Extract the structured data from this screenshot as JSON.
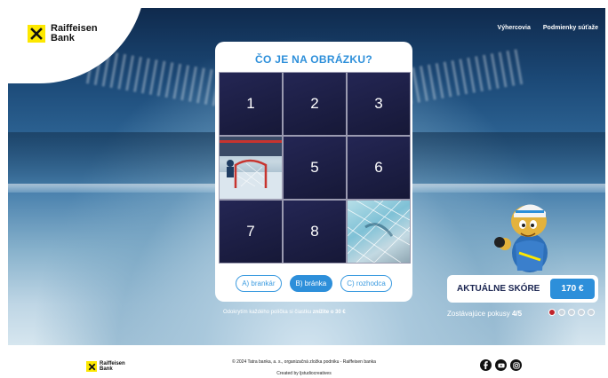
{
  "brand": {
    "line1": "Raiffeisen",
    "line2": "Bank"
  },
  "nav": {
    "winners": "Výhercovia",
    "terms": "Podmienky súťaže"
  },
  "quiz": {
    "title": "ČO JE NA OBRÁZKU?",
    "tiles": [
      {
        "label": "1",
        "revealed": false
      },
      {
        "label": "2",
        "revealed": false
      },
      {
        "label": "3",
        "revealed": false
      },
      {
        "label": "",
        "revealed": true
      },
      {
        "label": "5",
        "revealed": false
      },
      {
        "label": "6",
        "revealed": false
      },
      {
        "label": "7",
        "revealed": false
      },
      {
        "label": "8",
        "revealed": false
      },
      {
        "label": "",
        "revealed": true
      }
    ],
    "answers": [
      {
        "label": "A) brankár",
        "selected": false
      },
      {
        "label": "B) bránka",
        "selected": true
      },
      {
        "label": "C) rozhodca",
        "selected": false
      }
    ]
  },
  "hint": {
    "prefix": "Odokrytím každého políčka si čiastku ",
    "bold": "znížite o 30 €"
  },
  "score": {
    "label": "AKTUÁLNE SKÓRE",
    "value": "170 €"
  },
  "attempts": {
    "label": "Zostávajúce pokusy",
    "value": "4/5",
    "used": 1,
    "total": 5
  },
  "footer": {
    "brand_line1": "Raiffeisen",
    "brand_line2": "Bank",
    "copyright": "© 2024 Tatra banka, a. s., organizačná zložka podniku - Raiffeisen banka",
    "created": "Created by ljstudiocreatives"
  },
  "colors": {
    "accent": "#2d8fda",
    "brand_yellow": "#fde800",
    "tile_dark": "#1c1e45",
    "attempt_used": "#c0222a"
  },
  "icons": [
    "facebook-icon",
    "youtube-icon",
    "instagram-icon"
  ]
}
